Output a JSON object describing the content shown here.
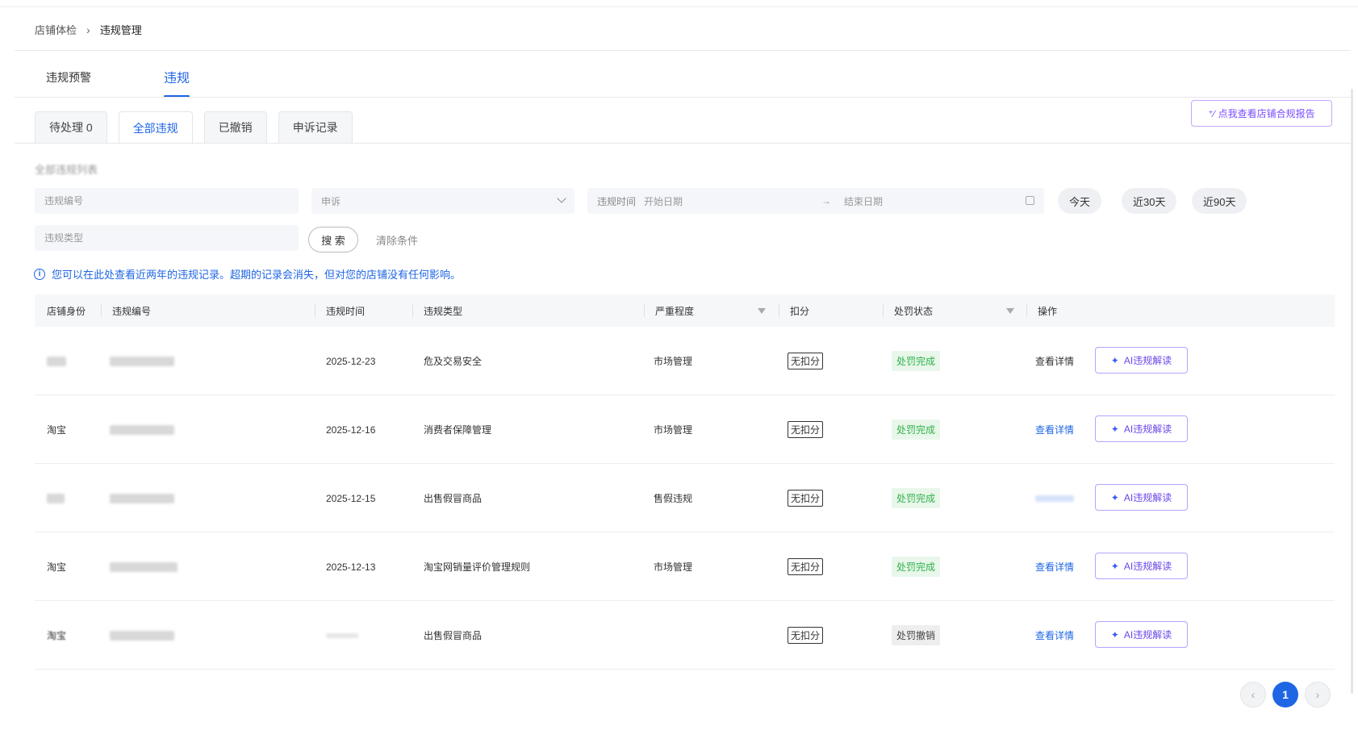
{
  "breadcrumb": {
    "parent": "店铺体检",
    "separator": "›",
    "current": "违规管理"
  },
  "main_tabs": [
    {
      "label": "违规预警"
    },
    {
      "label": "违规"
    }
  ],
  "report_button": {
    "label": "点我查看店铺合规报告"
  },
  "sub_tabs": [
    {
      "label": "待处理 0"
    },
    {
      "label": "全部违规"
    },
    {
      "label": "已撤销"
    },
    {
      "label": "申诉记录"
    }
  ],
  "list_title": "全部违规列表",
  "filters": {
    "violation_no_placeholder": "违规编号",
    "appeal_select": "申诉",
    "date_label": "违规时间",
    "start_placeholder": "开始日期",
    "end_placeholder": "结束日期",
    "quick_today": "今天",
    "quick_30": "近30天",
    "quick_90": "近90天",
    "type_placeholder": "违规类型",
    "search_label": "搜 索",
    "clear_label": "清除条件"
  },
  "notice": "您可以在此处查看近两年的违规记录。超期的记录会消失，但对您的店铺没有任何影响。",
  "table": {
    "headers": [
      "店铺身份",
      "违规编号",
      "违规时间",
      "违规类型",
      "严重程度",
      "扣分",
      "处罚状态",
      "操作"
    ],
    "rows": [
      {
        "shop": "",
        "date": "2025-12-23",
        "type": "危及交易安全",
        "severity": "市场管理",
        "deduct": "无扣分",
        "status": "处罚完成",
        "status_kind": "done",
        "detail": "查看详情",
        "ai": "AI违规解读"
      },
      {
        "shop": "淘宝",
        "date": "2025-12-16",
        "type": "消费者保障管理",
        "severity": "市场管理",
        "deduct": "无扣分",
        "status": "处罚完成",
        "status_kind": "done",
        "detail": "查看详情",
        "ai": "AI违规解读"
      },
      {
        "shop": "",
        "date": "2025-12-15",
        "type": "出售假冒商品",
        "severity": "售假违规",
        "deduct": "无扣分",
        "status": "处罚完成",
        "status_kind": "done",
        "detail": "",
        "ai": "AI违规解读"
      },
      {
        "shop": "淘宝",
        "date": "2025-12-13",
        "type": "淘宝网销量评价管理规则",
        "severity": "市场管理",
        "deduct": "无扣分",
        "status": "处罚完成",
        "status_kind": "done",
        "detail": "查看详情",
        "ai": "AI违规解读"
      },
      {
        "shop": "淘宝",
        "date": "",
        "type": "出售假冒商品",
        "severity": "",
        "deduct": "无扣分",
        "status": "处罚撤销",
        "status_kind": "cancel",
        "detail": "查看详情",
        "ai": "AI违规解读"
      }
    ]
  },
  "pagination": {
    "prev": "‹",
    "current": "1",
    "next": "›"
  },
  "colors": {
    "primary": "#1f66e5",
    "ai_purple": "#6a45e8",
    "success": "#2fb24a"
  }
}
